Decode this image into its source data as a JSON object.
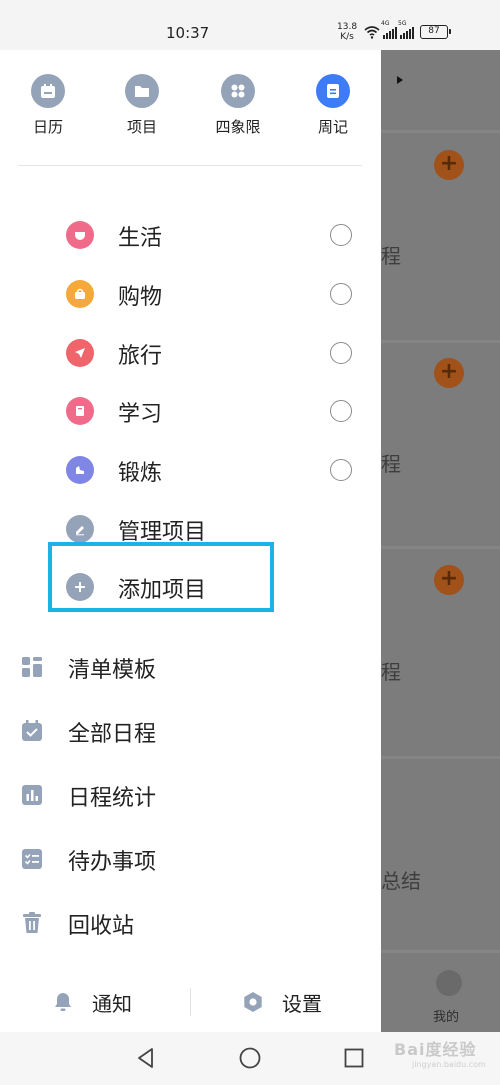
{
  "status_bar": {
    "time": "10:37",
    "net_speed_value": "13.8",
    "net_speed_unit": "K/s",
    "signal1_label": "4G",
    "signal2_label": "5G",
    "battery": "87"
  },
  "top_tabs": [
    {
      "label": "日历",
      "icon": "calendar-icon"
    },
    {
      "label": "项目",
      "icon": "folder-icon"
    },
    {
      "label": "四象限",
      "icon": "grid-icon"
    },
    {
      "label": "周记",
      "icon": "note-icon"
    }
  ],
  "projects": [
    {
      "label": "生活",
      "icon": "cup-icon",
      "color": "#f06b8a"
    },
    {
      "label": "购物",
      "icon": "basket-icon",
      "color": "#f4a93a"
    },
    {
      "label": "旅行",
      "icon": "plane-icon",
      "color": "#f0646b"
    },
    {
      "label": "学习",
      "icon": "book-icon",
      "color": "#f06b8a"
    },
    {
      "label": "锻炼",
      "icon": "arm-icon",
      "color": "#7f86e6"
    }
  ],
  "manage_projects": {
    "label": "管理项目",
    "icon": "pencil-icon"
  },
  "add_project": {
    "label": "添加项目",
    "icon": "plus-icon"
  },
  "menu": [
    {
      "label": "清单模板",
      "icon": "template-icon"
    },
    {
      "label": "全部日程",
      "icon": "calendar-check-icon"
    },
    {
      "label": "日程统计",
      "icon": "stats-icon"
    },
    {
      "label": "待办事项",
      "icon": "checklist-icon"
    },
    {
      "label": "回收站",
      "icon": "trash-icon"
    }
  ],
  "bottom": {
    "notify_label": "通知",
    "settings_label": "设置"
  },
  "background": {
    "text1": "程",
    "text2": "程",
    "text3": "程",
    "text4": "总结",
    "mine_label": "我的"
  },
  "watermark": {
    "text": "Bai度经验",
    "sub": "jingyan.baidu.com"
  },
  "colors": {
    "accent": "#3d7bf7",
    "highlight": "#1bb3e6",
    "icon_gray": "#94a3b8"
  }
}
